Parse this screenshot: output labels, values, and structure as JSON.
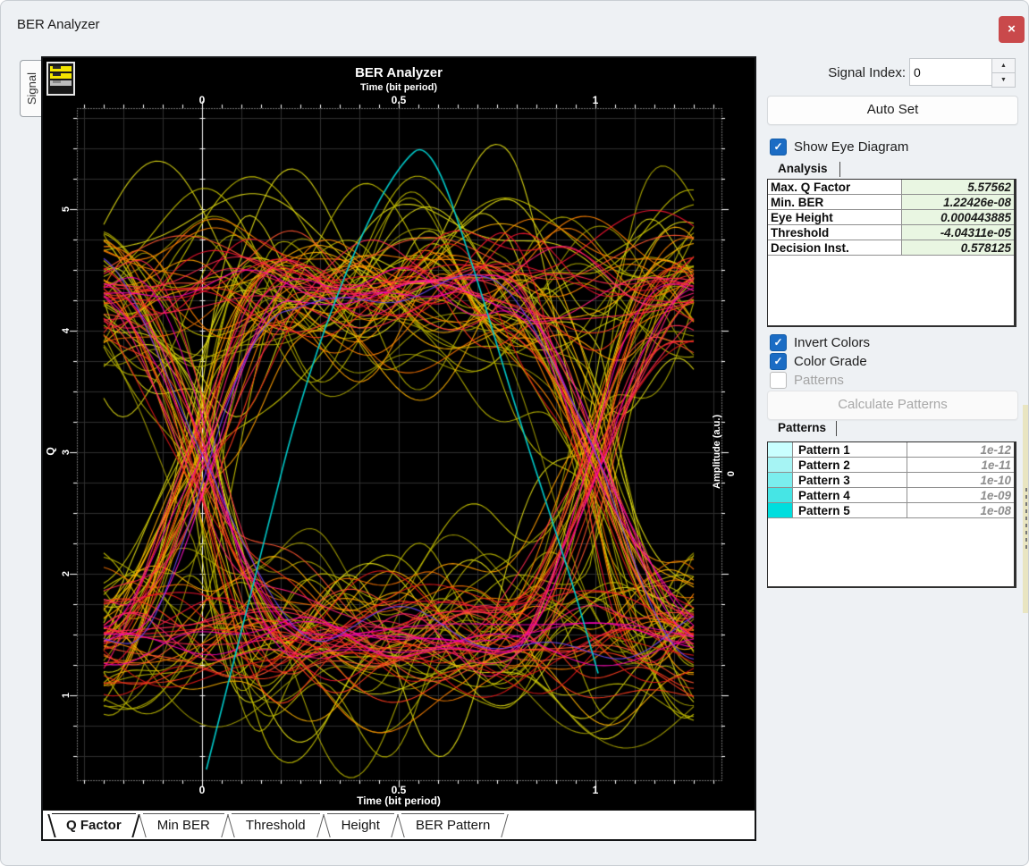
{
  "window": {
    "title": "BER Analyzer",
    "close_glyph": "×"
  },
  "left_tab": {
    "label": "Signal"
  },
  "panel": {
    "signal_index_label": "Signal Index:",
    "signal_index_value": "0",
    "auto_set": "Auto Set",
    "show_eye": "Show Eye Diagram",
    "analysis_tab": "Analysis",
    "analysis_rows": [
      {
        "name": "Max. Q Factor",
        "value": "5.57562"
      },
      {
        "name": "Min. BER",
        "value": "1.22426e-08"
      },
      {
        "name": "Eye Height",
        "value": "0.000443885"
      },
      {
        "name": "Threshold",
        "value": "-4.04311e-05"
      },
      {
        "name": "Decision Inst.",
        "value": "0.578125"
      }
    ],
    "invert_colors": "Invert Colors",
    "color_grade": "Color Grade",
    "patterns_checkbox": "Patterns",
    "calculate_patterns": "Calculate Patterns",
    "patterns_tab": "Patterns",
    "pattern_rows": [
      {
        "color": "#c9ffff",
        "name": "Pattern 1",
        "value": "1e-12"
      },
      {
        "color": "#a6f4f4",
        "name": "Pattern 2",
        "value": "1e-11"
      },
      {
        "color": "#7beeee",
        "name": "Pattern 3",
        "value": "1e-10"
      },
      {
        "color": "#46e5e5",
        "name": "Pattern 4",
        "value": "1e-09"
      },
      {
        "color": "#00dede",
        "name": "Pattern 5",
        "value": "1e-08"
      }
    ],
    "checkbox_states": {
      "show_eye": true,
      "invert_colors": true,
      "color_grade": true,
      "patterns": false
    }
  },
  "bottom_tabs": [
    {
      "label": "Q Factor",
      "active": true
    },
    {
      "label": "Min BER",
      "active": false
    },
    {
      "label": "Threshold",
      "active": false
    },
    {
      "label": "Height",
      "active": false
    },
    {
      "label": "BER Pattern",
      "active": false
    }
  ],
  "chart_data": {
    "type": "line",
    "subtype": "eye-diagram-with-q-curve",
    "title": "BER Analyzer",
    "x_axis_label": "Time (bit period)",
    "y_left_label": "Q",
    "y_right_label": "Amplitude (a.u.)",
    "x_ticks": [
      0,
      0.5,
      1
    ],
    "x_minor_tick": 0.05,
    "x_range": [
      -0.318,
      1.321
    ],
    "y_left_ticks": [
      5,
      4,
      3,
      2,
      1
    ],
    "y_minor_tick": 0.25,
    "y_range_q": [
      0.3,
      5.83
    ],
    "y_right_ticks": [
      {
        "label": "0",
        "q_position": 2.82
      }
    ],
    "grid": true,
    "grid_color": "#2f2f2f",
    "background": "#000000",
    "axis_color": "#ffffff",
    "time_zero_marker": 0,
    "eye": {
      "trace_time_span": [
        -0.25,
        1.25
      ],
      "high_rail_q": 4.35,
      "low_rail_q": 1.45,
      "crossing_times": [
        0,
        1
      ],
      "color_grade_layers": [
        {
          "name": "yellow-outer",
          "colors": [
            "#b6b200",
            "#ccc800",
            "#e0dc14",
            "#a19c00"
          ],
          "count": 52,
          "ripple": [
            0.28,
            0.55
          ],
          "rail_jitter": 0.45,
          "overshoot": [
            0.5,
            1.15
          ]
        },
        {
          "name": "orange",
          "colors": [
            "#ff9e00",
            "#ff8300",
            "#ea6d00",
            "#ffb300"
          ],
          "count": 26,
          "ripple": [
            0.2,
            0.4
          ],
          "rail_jitter": 0.34,
          "overshoot": [
            0.3,
            0.8
          ]
        },
        {
          "name": "red",
          "colors": [
            "#ff3c1e",
            "#f21430",
            "#ff5530",
            "#e01818"
          ],
          "count": 30,
          "ripple": [
            0.14,
            0.3
          ],
          "rail_jitter": 0.26,
          "overshoot": [
            0.2,
            0.55
          ]
        },
        {
          "name": "crimson",
          "colors": [
            "#ff1e78",
            "#ff2a50"
          ],
          "count": 12,
          "ripple": [
            0.1,
            0.22
          ],
          "rail_jitter": 0.18,
          "overshoot": [
            0.15,
            0.4
          ]
        },
        {
          "name": "magenta-core",
          "colors": [
            "#ff14c8",
            "#f400ae"
          ],
          "count": 8,
          "ripple": [
            0.07,
            0.16
          ],
          "rail_jitter": 0.1,
          "overshoot": [
            0.1,
            0.3
          ]
        },
        {
          "name": "violet",
          "colors": [
            "#6a48f0"
          ],
          "count": 2,
          "ripple": [
            0.1,
            0.18
          ],
          "rail_jitter": 0.1,
          "overshoot": [
            0.1,
            0.2
          ]
        }
      ]
    },
    "series": [
      {
        "name": "Q factor vs decision instant",
        "color": "#00cccc",
        "points": [
          [
            0.011,
            0.39
          ],
          [
            0.148,
            2.16
          ],
          [
            0.261,
            3.57
          ],
          [
            0.398,
            4.76
          ],
          [
            0.5,
            5.36
          ],
          [
            0.578,
            5.58
          ],
          [
            0.693,
            4.5
          ],
          [
            0.795,
            3.39
          ],
          [
            0.875,
            2.58
          ],
          [
            0.943,
            1.91
          ],
          [
            1.007,
            1.18
          ]
        ]
      }
    ]
  }
}
